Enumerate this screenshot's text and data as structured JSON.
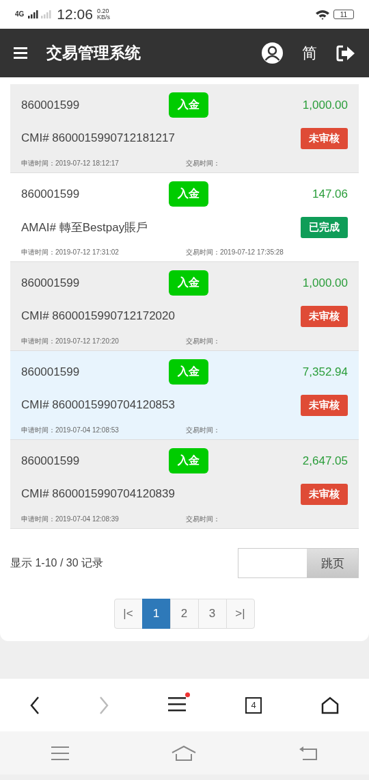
{
  "status_bar": {
    "network": "4G",
    "time": "12:06",
    "speed_value": "0.20",
    "speed_unit": "KB/s",
    "battery": "11"
  },
  "header": {
    "title": "交易管理系统",
    "language": "简"
  },
  "transactions": [
    {
      "account": "860001599",
      "type": "入金",
      "amount": "1,000.00",
      "reference": "CMI# 8600015990712181217",
      "status": {
        "text": "未审核",
        "color": "#df4b36"
      },
      "applied_time": "申请时间：2019-07-12 18:12:17",
      "trade_time": "交易时间：",
      "highlighted": false
    },
    {
      "account": "860001599",
      "type": "入金",
      "amount": "147.06",
      "reference": "AMAI# 轉至Bestpay賬戶",
      "status": {
        "text": "已完成",
        "color": "#0f9d58"
      },
      "applied_time": "申请时间：2019-07-12 17:31:02",
      "trade_time": "交易时间：2019-07-12 17:35:28",
      "highlighted": false
    },
    {
      "account": "860001599",
      "type": "入金",
      "amount": "1,000.00",
      "reference": "CMI# 8600015990712172020",
      "status": {
        "text": "未审核",
        "color": "#df4b36"
      },
      "applied_time": "申请时间：2019-07-12 17:20:20",
      "trade_time": "交易时间：",
      "highlighted": false
    },
    {
      "account": "860001599",
      "type": "入金",
      "amount": "7,352.94",
      "reference": "CMI# 8600015990704120853",
      "status": {
        "text": "未审核",
        "color": "#df4b36"
      },
      "applied_time": "申请时间：2019-07-04 12:08:53",
      "trade_time": "交易时间：",
      "highlighted": true
    },
    {
      "account": "860001599",
      "type": "入金",
      "amount": "2,647.05",
      "reference": "CMI# 8600015990704120839",
      "status": {
        "text": "未审核",
        "color": "#df4b36"
      },
      "applied_time": "申请时间：2019-07-04 12:08:39",
      "trade_time": "交易时间：",
      "highlighted": false
    }
  ],
  "summary": "显示 1-10 / 30 记录",
  "jump_button": "跳页",
  "pages": [
    {
      "label": "|<",
      "selected": false
    },
    {
      "label": "1",
      "selected": true
    },
    {
      "label": "2",
      "selected": false
    },
    {
      "label": "3",
      "selected": false
    },
    {
      "label": ">|",
      "selected": false
    }
  ],
  "browser_bar": {
    "tab_count": "4"
  }
}
